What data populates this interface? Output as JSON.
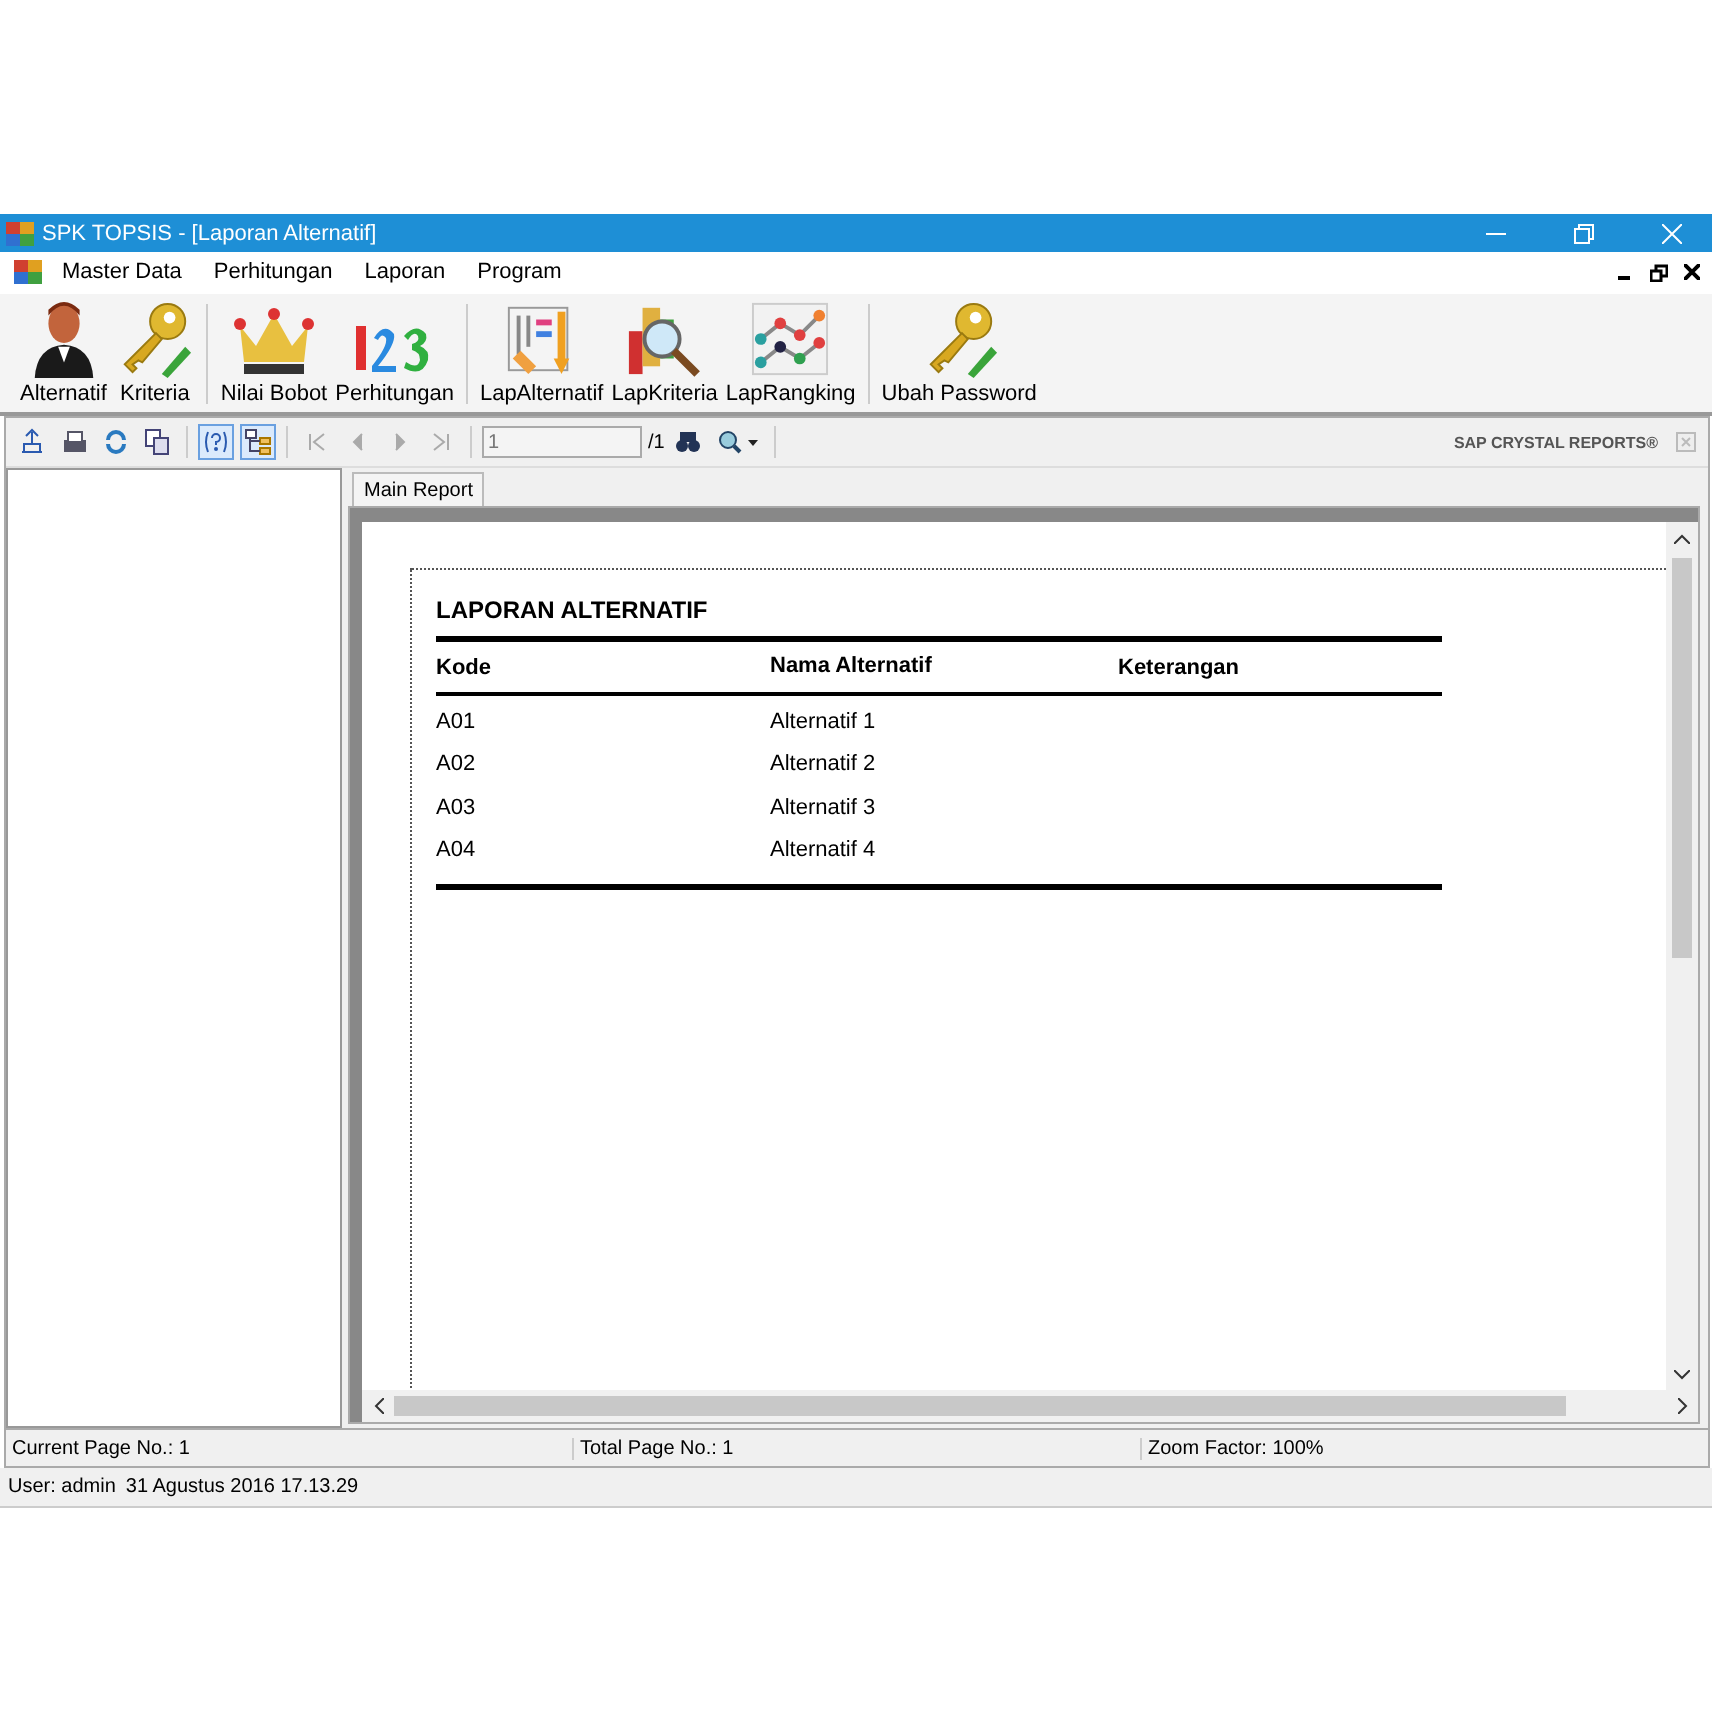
{
  "window": {
    "title": "SPK TOPSIS - [Laporan Alternatif]"
  },
  "menu": [
    "Master Data",
    "Perhitungan",
    "Laporan",
    "Program"
  ],
  "toolbar": [
    "Alternatif",
    "Kriteria",
    "Nilai Bobot",
    "Perhitungan",
    "LapAlternatif",
    "LapKriteria",
    "LapRangking",
    "Ubah Password"
  ],
  "viewer": {
    "toggle_help": true,
    "toggle_group_tree": true,
    "page_field": "1",
    "page_total": "/1",
    "brand": "SAP CRYSTAL REPORTS®",
    "tab": "Main Report",
    "report": {
      "title": "LAPORAN ALTERNATIF",
      "columns": [
        "Kode",
        "Nama Alternatif",
        "Keterangan"
      ],
      "rows": [
        [
          "A01",
          "Alternatif 1"
        ],
        [
          "A02",
          "Alternatif 2"
        ],
        [
          "A03",
          "Alternatif 3"
        ],
        [
          "A04",
          "Alternatif 4"
        ]
      ]
    }
  },
  "viewer_status": [
    "Current Page No.: 1",
    "Total Page No.: 1",
    "Zoom Factor: 100%"
  ],
  "status_bar": {
    "user": "User: admin",
    "datetime": "31 Agustus 2016 17.13.29"
  }
}
